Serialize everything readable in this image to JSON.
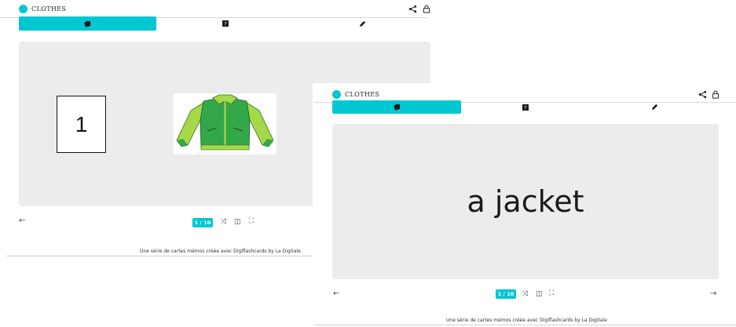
{
  "deck": {
    "title": "CLOTHES"
  },
  "card_left": {
    "number": "1",
    "image": "jacket-illustration"
  },
  "card_right": {
    "text": "a jacket"
  },
  "counter": "1 / 10",
  "footer": {
    "text": "Une série de cartes mémos créée avec Digiflashcards by La Digitale"
  },
  "icons": {
    "share": "share-icon",
    "lock": "lock-icon",
    "cards": "cards-icon",
    "quiz": "quiz-icon",
    "edit": "pencil-icon",
    "prev": "arrow-left-icon",
    "next": "arrow-right-icon",
    "shuffle": "shuffle-icon",
    "flip": "flip-icon",
    "fullscreen": "fullscreen-icon"
  },
  "colors": {
    "accent": "#00c8d2",
    "card_bg": "#ececec",
    "jacket_green": "#33a84a",
    "jacket_lime": "#a6d94a"
  }
}
